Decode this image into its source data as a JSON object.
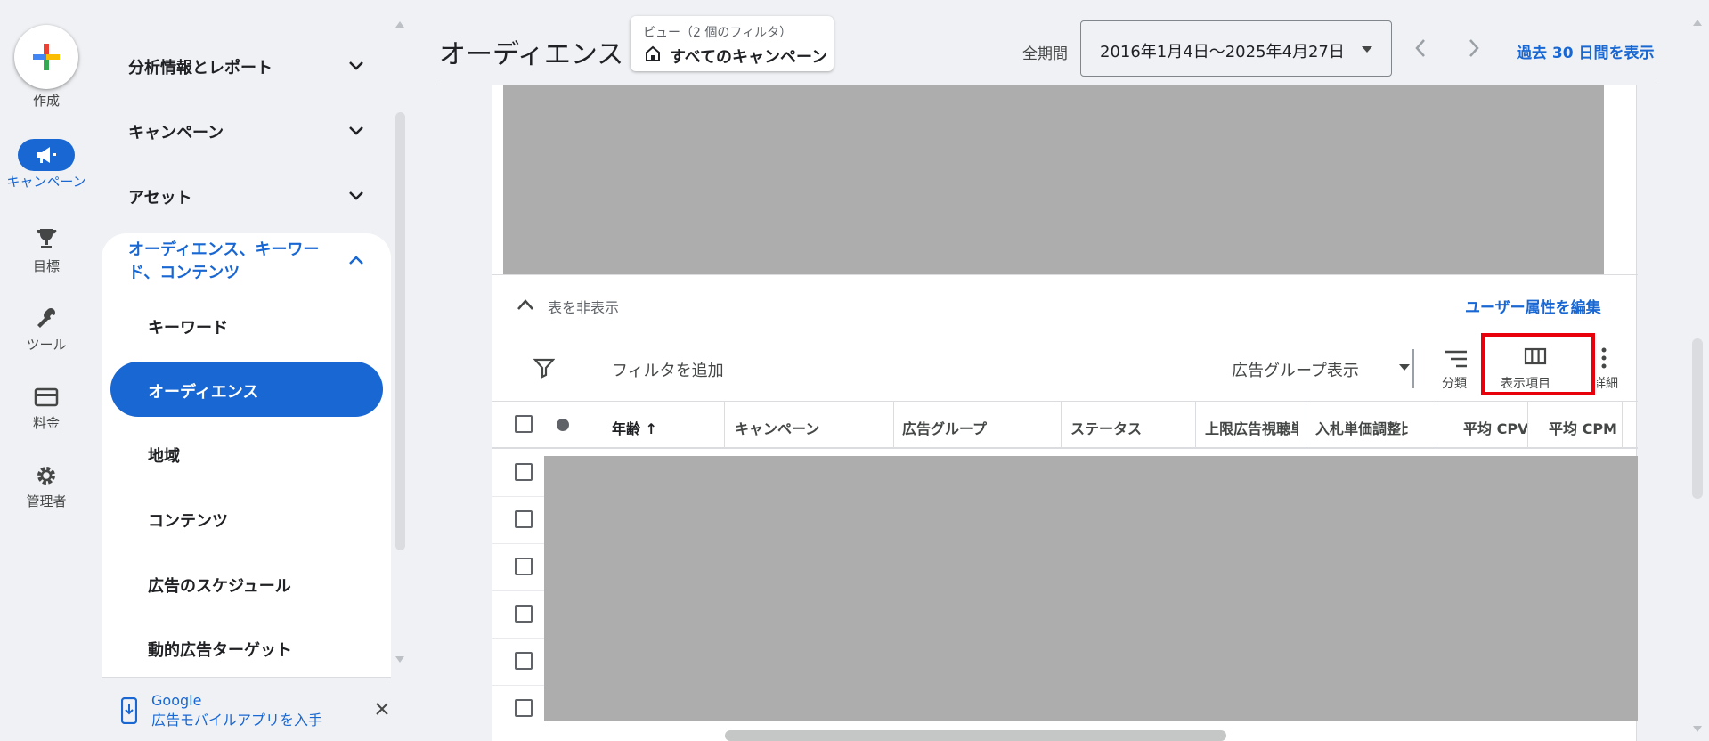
{
  "rail": {
    "create_label": "作成",
    "campaign_label": "キャンペーン",
    "goals_label": "目標",
    "tools_label": "ツール",
    "billing_label": "料金",
    "admin_label": "管理者"
  },
  "nav": {
    "group_insights": "分析情報とレポート",
    "group_campaigns": "キャンペーン",
    "group_assets": "アセット",
    "group_audiences_line1": "オーディエンス、キーワー",
    "group_audiences_line2": "ド、コンテンツ",
    "sub_keywords": "キーワード",
    "sub_audiences": "オーディエンス",
    "sub_locations": "地域",
    "sub_content": "コンテンツ",
    "sub_ad_schedule": "広告のスケジュール",
    "sub_dynamic_targets": "動的広告ターゲット",
    "app_promo_line1": "Google",
    "app_promo_line2": "広告モバイルアプリを入手"
  },
  "header": {
    "page_title": "オーディエンス",
    "view_caption": "ビュー（2 個のフィルタ）",
    "view_value": "すべてのキャンペーン",
    "period_label": "全期間",
    "date_range": "2016年1月4日〜2025年4月27日",
    "last30_link": "過去 30 日間を表示"
  },
  "table_area": {
    "hide_table": "表を非表示",
    "edit_demographics": "ユーザー属性を編集",
    "add_filter": "フィルタを追加",
    "ad_group_view": "広告グループ表示",
    "segment_label": "分類",
    "columns_label": "表示項目",
    "more_label": "詳細",
    "columns": [
      "年齢 ↑",
      "キャンペーン",
      "広告グループ",
      "ステータス",
      "上限広告視聴単",
      "入札単価調整比",
      "平均 CPV",
      "平均 CPM"
    ]
  },
  "colors": {
    "accent_blue": "#1967d2",
    "highlight_red": "#e8000b",
    "placeholder_gray": "#adadad"
  }
}
